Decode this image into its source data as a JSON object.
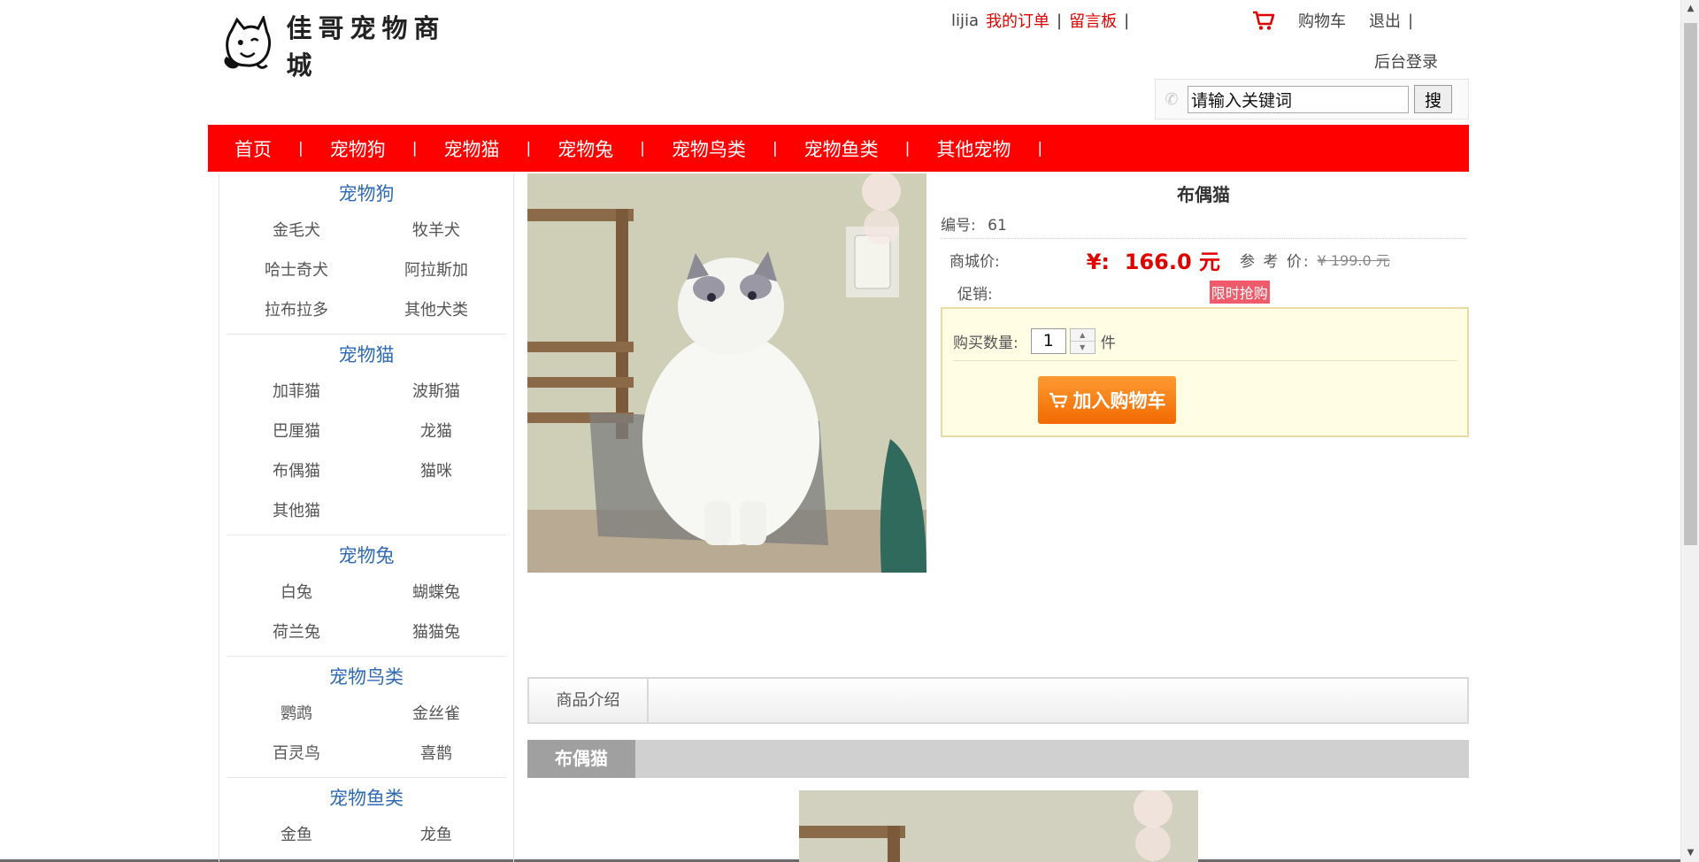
{
  "header": {
    "logo_text": "佳哥宠物商城",
    "user_name": "lijia",
    "my_orders": "我的订单",
    "message_board": "留言板",
    "separator": "|",
    "cart": "购物车",
    "logout": "退出",
    "admin_login": "后台登录",
    "search_placeholder": "请输入关键词",
    "search_value": "请输入关键词",
    "search_button": "搜"
  },
  "nav": {
    "items": [
      "首页",
      "宠物狗",
      "宠物猫",
      "宠物兔",
      "宠物鸟类",
      "宠物鱼类",
      "其他宠物"
    ],
    "separator": "|"
  },
  "sidebar": {
    "categories": [
      {
        "title": "宠物狗",
        "items": [
          "金毛犬",
          "牧羊犬",
          "哈士奇犬",
          "阿拉斯加",
          "拉布拉多",
          "其他犬类"
        ]
      },
      {
        "title": "宠物猫",
        "items": [
          "加菲猫",
          "波斯猫",
          "巴厘猫",
          "龙猫",
          "布偶猫",
          "猫咪",
          "其他猫"
        ]
      },
      {
        "title": "宠物兔",
        "items": [
          "白兔",
          "蝴蝶兔",
          "荷兰兔",
          "猫猫兔"
        ]
      },
      {
        "title": "宠物鸟类",
        "items": [
          "鹦鹉",
          "金丝雀",
          "百灵鸟",
          "喜鹊"
        ]
      },
      {
        "title": "宠物鱼类",
        "items": [
          "金鱼",
          "龙鱼"
        ]
      }
    ]
  },
  "product": {
    "name": "布偶猫",
    "id_label": "编号:",
    "id_value": "61",
    "price_label": "商城价:",
    "price": "¥:  166.0 元",
    "ref_label": "参 考 价:",
    "ref_price": "¥ 199.0 元",
    "promo_label": "促销:",
    "promo_badge": "限时抢购",
    "qty_label": "购买数量:",
    "qty_value": "1",
    "qty_unit": "件",
    "add_to_cart": "加入购物车"
  },
  "tabs": {
    "intro": "商品介绍"
  },
  "description": {
    "title": "布偶猫"
  },
  "colors": {
    "nav_bg": "#ff0000",
    "price": "#e00000",
    "category_title": "#2f6ab4",
    "button_orange": "#f47a10"
  }
}
